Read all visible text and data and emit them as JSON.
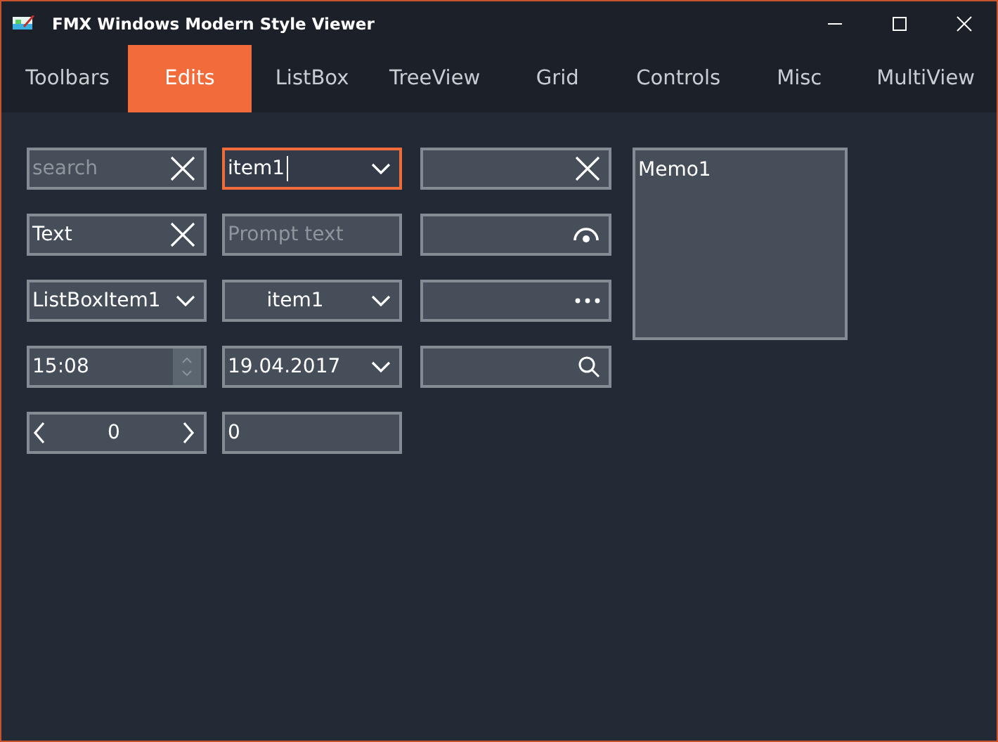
{
  "window": {
    "title": "FMX Windows Modern Style Viewer"
  },
  "tabs": [
    {
      "label": "Toolbars",
      "selected": false
    },
    {
      "label": "Edits",
      "selected": true
    },
    {
      "label": "ListBox",
      "selected": false
    },
    {
      "label": "TreeView",
      "selected": false
    },
    {
      "label": "Grid",
      "selected": false
    },
    {
      "label": "Controls",
      "selected": false
    },
    {
      "label": "Misc",
      "selected": false
    },
    {
      "label": "MultiView",
      "selected": false
    }
  ],
  "columns": [
    [
      {
        "kind": "clear",
        "placeholder": "search",
        "focused": false
      },
      {
        "kind": "clear",
        "value": "Text",
        "focused": false
      },
      {
        "kind": "combo",
        "value": "ListBoxItem1",
        "focused": false
      },
      {
        "kind": "time",
        "value": "15:08",
        "focused": false
      },
      {
        "kind": "stepper",
        "value": "0",
        "focused": false
      }
    ],
    [
      {
        "kind": "combo-edit",
        "value": "item1",
        "focused": true
      },
      {
        "kind": "plain",
        "placeholder": "Prompt text",
        "focused": false
      },
      {
        "kind": "combo-center",
        "value": "item1",
        "focused": false
      },
      {
        "kind": "combo",
        "value": "19.04.2017",
        "focused": false
      },
      {
        "kind": "plain",
        "value": "0",
        "focused": false
      }
    ],
    [
      {
        "kind": "clear",
        "focused": false
      },
      {
        "kind": "password",
        "focused": false
      },
      {
        "kind": "ellipsis",
        "focused": false
      },
      {
        "kind": "search",
        "focused": false
      }
    ]
  ],
  "memo": {
    "value": "Memo1"
  }
}
